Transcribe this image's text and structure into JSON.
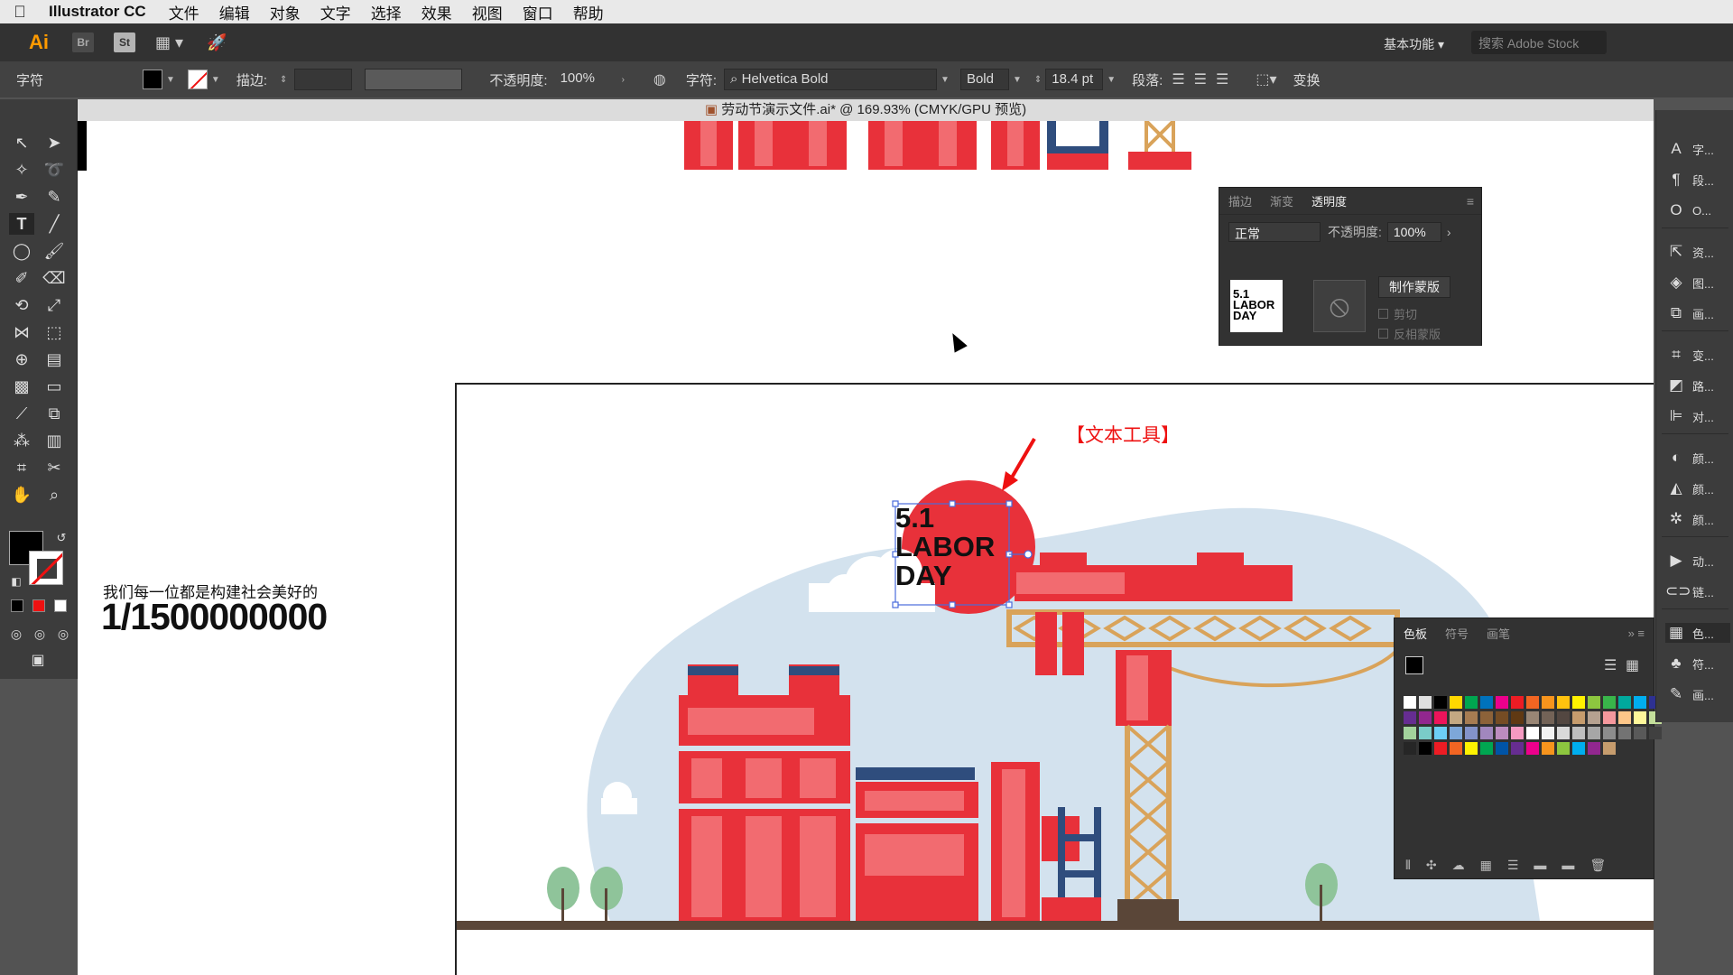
{
  "menubar": {
    "app_name": "Illustrator CC",
    "items": [
      "文件",
      "编辑",
      "对象",
      "文字",
      "选择",
      "效果",
      "视图",
      "窗口",
      "帮助"
    ]
  },
  "appbar": {
    "logo": "Ai",
    "bridge": "Br",
    "stock": "St",
    "workspace": "基本功能 ▾",
    "search_placeholder": "搜索 Adobe Stock"
  },
  "controlbar": {
    "selection_type": "字符",
    "stroke_label": "描边:",
    "opacity_label": "不透明度:",
    "opacity_value": "100%",
    "character_label": "字符:",
    "font_family": "Helvetica Bold",
    "font_style": "Bold",
    "font_size": "18.4 pt",
    "paragraph_label": "段落:",
    "transform_label": "变换"
  },
  "document": {
    "tab_title": "劳动节演示文件.ai* @ 169.93% (CMYK/GPU 预览)"
  },
  "canvas": {
    "slogan": "我们每一位都是构建社会美好的",
    "big_number": "1/1500000000",
    "annotation": "【文本工具】",
    "label_line1": "5.1",
    "label_line2": "LABOR",
    "label_line3": "DAY"
  },
  "transparency_panel": {
    "tabs": [
      "描边",
      "渐变",
      "透明度"
    ],
    "active_tab": "透明度",
    "blend_mode": "正常",
    "opacity_label": "不透明度:",
    "opacity_value": "100%",
    "make_mask": "制作蒙版",
    "clip": "剪切",
    "invert_mask": "反相蒙版",
    "thumb_text": "5.1 LABOR DAY"
  },
  "swatches_panel": {
    "tabs": [
      "色板",
      "符号",
      "画笔"
    ],
    "active_tab": "色板",
    "colors": [
      "#ffffff",
      "#e0e0e0",
      "#000000",
      "#ffd800",
      "#00a650",
      "#0072bc",
      "#ec008c",
      "#ed1c24",
      "#f26522",
      "#f7941d",
      "#ffc20e",
      "#fff200",
      "#8dc63f",
      "#39b54a",
      "#00a99d",
      "#00aeef",
      "#2e3192",
      "#662d91",
      "#92278f",
      "#ed145b",
      "#c4a882",
      "#a67c52",
      "#8c6239",
      "#754c24",
      "#603913",
      "#998675",
      "#736357",
      "#534741",
      "#c69c6d",
      "#b5a190",
      "#f5989d",
      "#fdc689",
      "#fff79a",
      "#c4df9b",
      "#a3d39c",
      "#7accc8",
      "#6dcff6",
      "#7da7d9",
      "#8393ca",
      "#a187be",
      "#bd8cbf",
      "#f49ac1",
      "#ffffff",
      "#f2f2f2",
      "#d9d9d9",
      "#bfbfbf",
      "#a6a6a6",
      "#8c8c8c",
      "#737373",
      "#595959",
      "#404040",
      "#262626",
      "#000000",
      "#ed1c24",
      "#f26522",
      "#fff200",
      "#00a651",
      "#0054a6",
      "#662d91",
      "#ec008c",
      "#f7941d",
      "#8dc63f",
      "#00aeef",
      "#92278f",
      "#c69c6d"
    ]
  },
  "dock": {
    "items": [
      "字...",
      "段...",
      "O...",
      "资...",
      "图...",
      "画...",
      "变...",
      "路...",
      "对...",
      "颜...",
      "颜...",
      "颜...",
      "动...",
      "链...",
      "色...",
      "符...",
      "画..."
    ]
  },
  "colors": {
    "accent_red": "#e8313a",
    "crane_gold": "#d9a35a",
    "sky_blue": "#d3e2ee",
    "ground": "#5a4638"
  }
}
